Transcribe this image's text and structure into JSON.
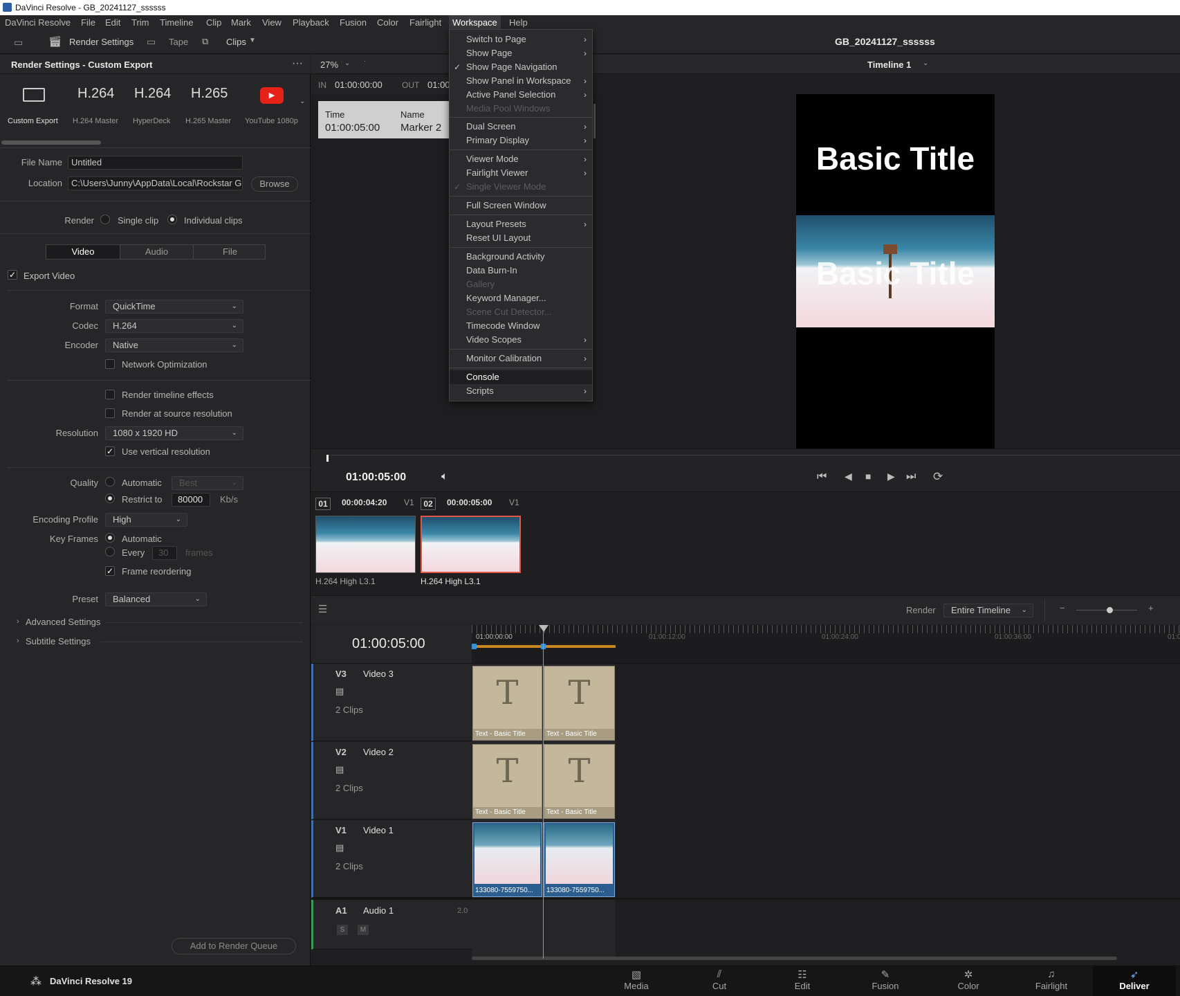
{
  "window": {
    "title": "DaVinci Resolve - GB_20241127_ssssss"
  },
  "menubar": {
    "items": [
      "DaVinci Resolve",
      "File",
      "Edit",
      "Trim",
      "Timeline",
      "Clip",
      "Mark",
      "View",
      "Playback",
      "Fusion",
      "Color",
      "Fairlight",
      "Workspace",
      "Help"
    ]
  },
  "toolbar": {
    "render_settings": "Render Settings",
    "tape": "Tape",
    "clips": "Clips",
    "project_name": "GB_20241127_ssssss"
  },
  "render_panel": {
    "title": "Render Settings - Custom Export",
    "presets": [
      {
        "big": "",
        "label": "Custom Export"
      },
      {
        "big": "H.264",
        "label": "H.264 Master"
      },
      {
        "big": "H.264",
        "label": "HyperDeck"
      },
      {
        "big": "H.265",
        "label": "H.265 Master"
      },
      {
        "big": "",
        "label": "YouTube 1080p"
      }
    ],
    "file_name_label": "File Name",
    "file_name": "Untitled",
    "location_label": "Location",
    "location": "C:\\Users\\Junny\\AppData\\Local\\Rockstar G",
    "browse": "Browse",
    "render_label": "Render",
    "single_clip": "Single clip",
    "individual_clips": "Individual clips",
    "tabs": [
      "Video",
      "Audio",
      "File"
    ],
    "export_video": "Export Video",
    "format_label": "Format",
    "format": "QuickTime",
    "codec_label": "Codec",
    "codec": "H.264",
    "encoder_label": "Encoder",
    "encoder": "Native",
    "network_opt": "Network Optimization",
    "render_timeline_effects": "Render timeline effects",
    "render_source_res": "Render at source resolution",
    "resolution_label": "Resolution",
    "resolution": "1080 x 1920 HD",
    "use_vertical": "Use vertical resolution",
    "quality_label": "Quality",
    "automatic": "Automatic",
    "best": "Best",
    "restrict_to": "Restrict to",
    "restrict_value": "80000",
    "kbs": "Kb/s",
    "encoding_profile_label": "Encoding Profile",
    "encoding_profile": "High",
    "key_frames_label": "Key Frames",
    "kf_automatic": "Automatic",
    "kf_every": "Every",
    "kf_value": "30",
    "kf_frames": "frames",
    "frame_reordering": "Frame reordering",
    "preset_label": "Preset",
    "preset": "Balanced",
    "advanced_settings": "Advanced Settings",
    "subtitle_settings": "Subtitle Settings",
    "add_to_queue": "Add to Render Queue"
  },
  "viewer": {
    "zoom": "27%",
    "in_label": "IN",
    "in_tc": "01:00:00:00",
    "out_label": "OUT",
    "out_tc": "01:00",
    "marker_time_h": "Time",
    "marker_name_h": "Name",
    "marker_time": "01:00:05:00",
    "marker_name": "Marker 2",
    "timeline_name": "Timeline 1",
    "title_top": "Basic Title",
    "title_mid": "Basic Title",
    "timecode": "01:00:05:00"
  },
  "workspace_menu": {
    "items": [
      {
        "label": "Switch to Page",
        "sub": true
      },
      {
        "label": "Show Page",
        "sub": true
      },
      {
        "label": "Show Page Navigation",
        "checked": true
      },
      {
        "label": "Show Panel in Workspace",
        "sub": true
      },
      {
        "label": "Active Panel Selection",
        "sub": true
      },
      {
        "label": "Media Pool Windows",
        "disabled": true
      },
      {
        "label": "Dual Screen",
        "sub": true
      },
      {
        "label": "Primary Display",
        "sub": true
      },
      {
        "label": "Viewer Mode",
        "sub": true
      },
      {
        "label": "Fairlight Viewer",
        "sub": true
      },
      {
        "label": "Single Viewer Mode",
        "disabled": true,
        "checked": true
      },
      {
        "label": "Full Screen Window"
      },
      {
        "label": "Layout Presets",
        "sub": true
      },
      {
        "label": "Reset UI Layout"
      },
      {
        "label": "Background Activity"
      },
      {
        "label": "Data Burn-In"
      },
      {
        "label": "Gallery",
        "disabled": true
      },
      {
        "label": "Keyword Manager..."
      },
      {
        "label": "Scene Cut Detector...",
        "disabled": true
      },
      {
        "label": "Timecode Window"
      },
      {
        "label": "Video Scopes",
        "sub": true
      },
      {
        "label": "Monitor Calibration",
        "sub": true
      },
      {
        "label": "Console",
        "highlight": true
      },
      {
        "label": "Scripts",
        "sub": true
      }
    ]
  },
  "clips_strip": [
    {
      "num": "01",
      "tc": "00:00:04:20",
      "track": "V1",
      "codec": "H.264 High L3.1"
    },
    {
      "num": "02",
      "tc": "00:00:05:00",
      "track": "V1",
      "codec": "H.264 High L3.1"
    }
  ],
  "timeline": {
    "render_label": "Render",
    "render_scope": "Entire Timeline",
    "timecode": "01:00:05:00",
    "ruler": [
      "01:00:00:00",
      "01:00:12:00",
      "01:00:24:00",
      "01:00:36:00",
      "01:0"
    ],
    "tracks": [
      {
        "id": "V3",
        "name": "Video 3",
        "clips": "2 Clips",
        "clip_label": "Text - Basic Title"
      },
      {
        "id": "V2",
        "name": "Video 2",
        "clips": "2 Clips",
        "clip_label": "Text - Basic Title"
      },
      {
        "id": "V1",
        "name": "Video 1",
        "clips": "2 Clips",
        "clip_label": "133080-7559750..."
      },
      {
        "id": "A1",
        "name": "Audio 1",
        "ch": "2.0",
        "solo": "S",
        "mute": "M"
      }
    ]
  },
  "bottom_nav": {
    "brand": "DaVinci Resolve 19",
    "pages": [
      "Media",
      "Cut",
      "Edit",
      "Fusion",
      "Color",
      "Fairlight",
      "Deliver"
    ]
  }
}
